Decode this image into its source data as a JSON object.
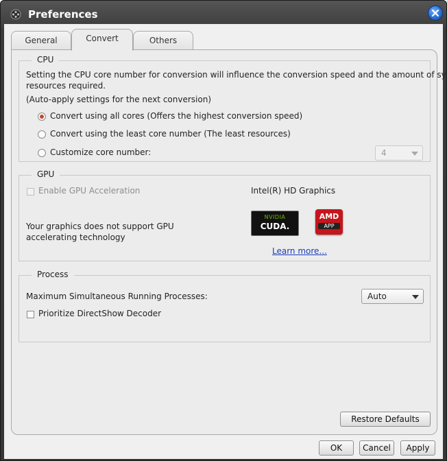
{
  "window": {
    "title": "Preferences"
  },
  "tabs": [
    {
      "label": "General"
    },
    {
      "label": "Convert"
    },
    {
      "label": "Others"
    }
  ],
  "cpu": {
    "title": "CPU",
    "description": "Setting the CPU core number for conversion will influence the conversion speed and the amount of system",
    "description_line2": "resources required.",
    "auto_note": "(Auto-apply settings for the next conversion)",
    "options": [
      {
        "label": "Convert using all cores (Offers the highest conversion speed)",
        "selected": true
      },
      {
        "label": "Convert using the least core number (The least resources)",
        "selected": false
      },
      {
        "label": "Customize core number:",
        "selected": false
      }
    ],
    "core_number": "4"
  },
  "gpu": {
    "title": "GPU",
    "enable_label": "Enable GPU Acceleration",
    "graphics_name": "Intel(R) HD Graphics",
    "not_supported_line1": "Your graphics does not support GPU",
    "not_supported_line2": "accelerating technology",
    "nvidia_logo": {
      "brand": "NVIDIA",
      "product": "CUDA."
    },
    "amd_logo": {
      "brand": "AMD",
      "product": "APP"
    },
    "learn_more": "Learn more..."
  },
  "process": {
    "title": "Process",
    "max_label": "Maximum Simultaneous Running Processes:",
    "max_value": "Auto",
    "directshow_label": "Prioritize DirectShow Decoder"
  },
  "buttons": {
    "restore_defaults": "Restore Defaults",
    "ok": "OK",
    "cancel": "Cancel",
    "apply": "Apply"
  },
  "colors": {
    "title_bar": "#3d3d3d",
    "radio_selected": "#c9472a",
    "link": "#1a3dbb",
    "close_button": "#2a6fd3"
  },
  "icons": {
    "app": "film-reel-icon",
    "close": "close-icon"
  }
}
